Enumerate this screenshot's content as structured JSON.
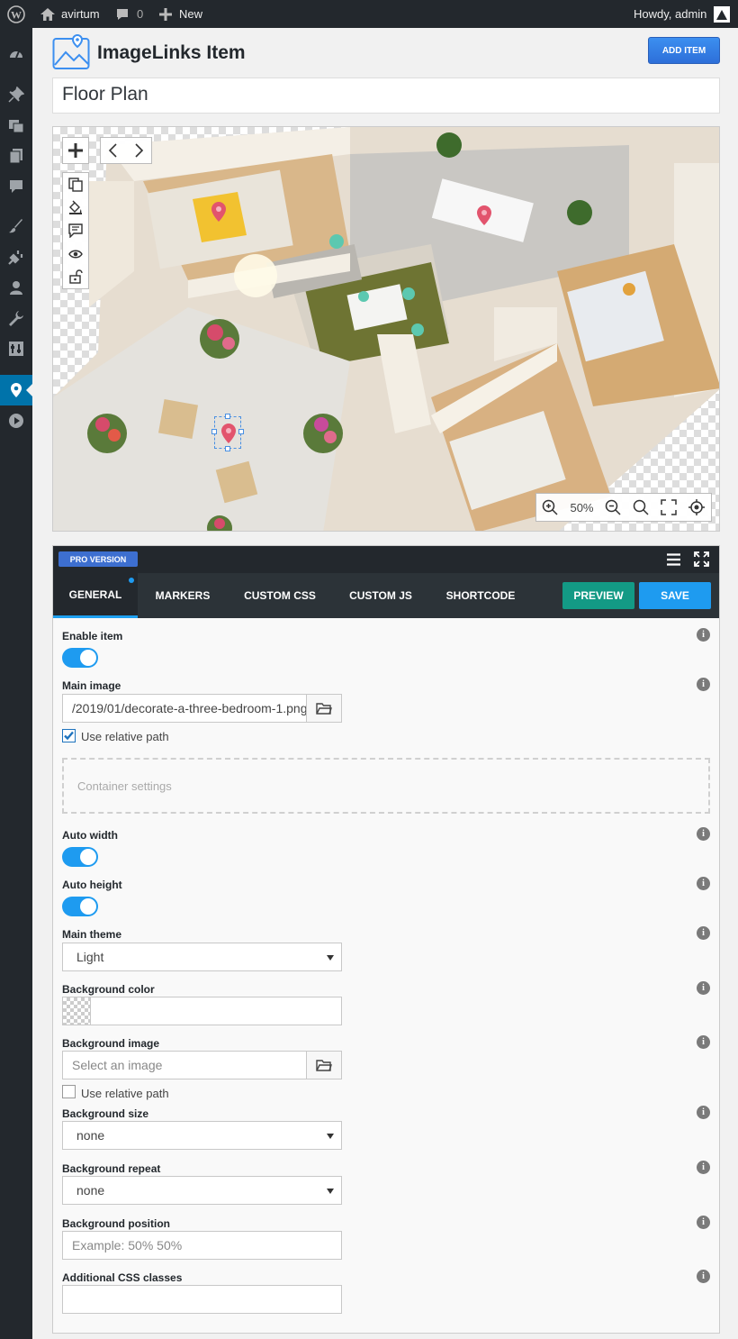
{
  "admin_bar": {
    "site_name": "avirtum",
    "comments_count": "0",
    "new_label": "New",
    "greeting": "Howdy, admin"
  },
  "header": {
    "app_title": "ImageLinks Item",
    "add_item_label": "ADD ITEM"
  },
  "item_title": "Floor Plan",
  "canvas": {
    "zoom_level": "50%"
  },
  "panel": {
    "pro_badge": "PRO VERSION",
    "tabs": [
      {
        "label": "GENERAL",
        "active": true
      },
      {
        "label": "MARKERS",
        "active": false
      },
      {
        "label": "CUSTOM CSS",
        "active": false
      },
      {
        "label": "CUSTOM JS",
        "active": false
      },
      {
        "label": "SHORTCODE",
        "active": false
      }
    ],
    "preview_label": "PREVIEW",
    "save_label": "SAVE"
  },
  "form": {
    "enable_item": {
      "label": "Enable item",
      "value": true
    },
    "main_image": {
      "label": "Main image",
      "value": "/2019/01/decorate-a-three-bedroom-1.png",
      "relative_label": "Use relative path",
      "relative_checked": true
    },
    "container_settings": "Container settings",
    "auto_width": {
      "label": "Auto width",
      "value": true
    },
    "auto_height": {
      "label": "Auto height",
      "value": true
    },
    "main_theme": {
      "label": "Main theme",
      "value": "Light"
    },
    "background_color": {
      "label": "Background color",
      "value": ""
    },
    "background_image": {
      "label": "Background image",
      "placeholder": "Select an image",
      "relative_label": "Use relative path",
      "relative_checked": false
    },
    "background_size": {
      "label": "Background size",
      "value": "none"
    },
    "background_repeat": {
      "label": "Background repeat",
      "value": "none"
    },
    "background_position": {
      "label": "Background position",
      "placeholder": "Example: 50% 50%"
    },
    "css_classes": {
      "label": "Additional CSS classes",
      "value": ""
    }
  },
  "colors": {
    "accent": "#1e9bf0",
    "preview": "#139a85",
    "admin_bar": "#23282d",
    "menu_current": "#0073aa"
  }
}
